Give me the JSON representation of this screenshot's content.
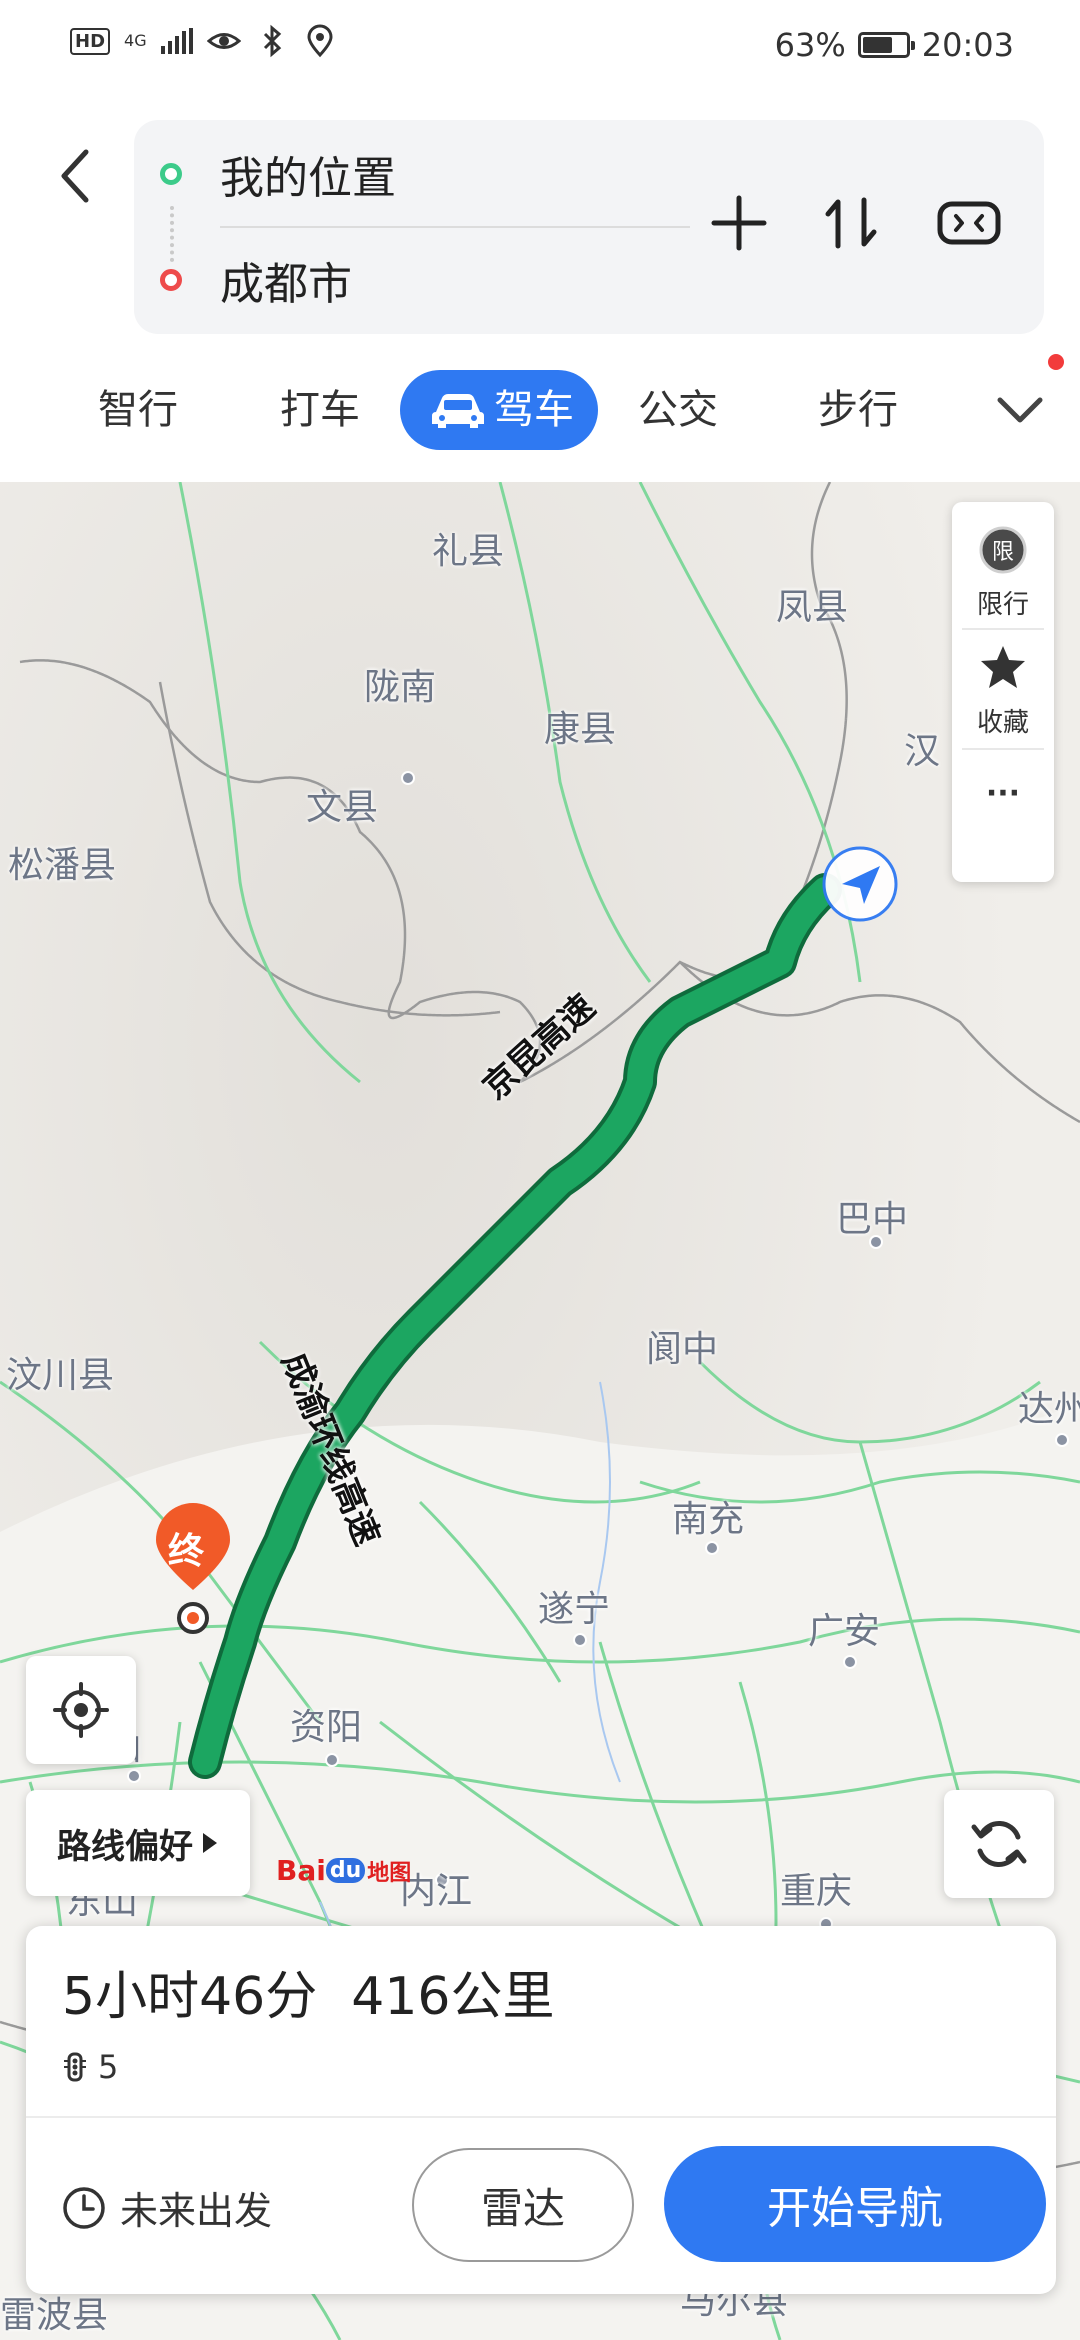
{
  "status_bar": {
    "hd": "HD",
    "signal": "4G",
    "battery": "63%",
    "battery_level": 0.63,
    "time": "20:03"
  },
  "route": {
    "origin": "我的位置",
    "destination": "成都市",
    "icons": [
      "back-icon",
      "add-waypoint-icon",
      "swap-icon",
      "toggle-icon"
    ]
  },
  "modes": [
    {
      "label": "智行"
    },
    {
      "label": "打车"
    },
    {
      "label": "驾车",
      "active": true
    },
    {
      "label": "公交"
    },
    {
      "label": "步行"
    }
  ],
  "map": {
    "places": [
      "礼县",
      "凤县",
      "陇南",
      "康县",
      "文县",
      "汉",
      "松潘县",
      "巴中",
      "阆中",
      "汶川县",
      "达州",
      "南充",
      "遂宁",
      "广安",
      "资阳",
      "山",
      "内江",
      "重庆",
      "东山",
      "雷波县",
      "马尔县"
    ],
    "road_labels": [
      "京昆高速",
      "成渝环线高速"
    ],
    "end_marker": "终",
    "side_panel": {
      "restrict_badge": "限",
      "restrict_label": "限行",
      "favorite_label": "收藏",
      "more_label": "···"
    },
    "route_pref": "路线偏好",
    "logo_text_1": "Bai",
    "logo_text_2": "du",
    "logo_text_3": "地图"
  },
  "summary": {
    "duration": "5小时46分",
    "distance": "416公里",
    "traffic_lights": "5",
    "depart_later": "未来出发",
    "radar": "雷达",
    "start_nav": "开始导航"
  },
  "colors": {
    "accent": "#2f79f2",
    "route_green": "#17a35c",
    "origin_dot": "#3ccb8a",
    "dest_dot": "#ee4b4b",
    "marker": "#f15a28"
  }
}
